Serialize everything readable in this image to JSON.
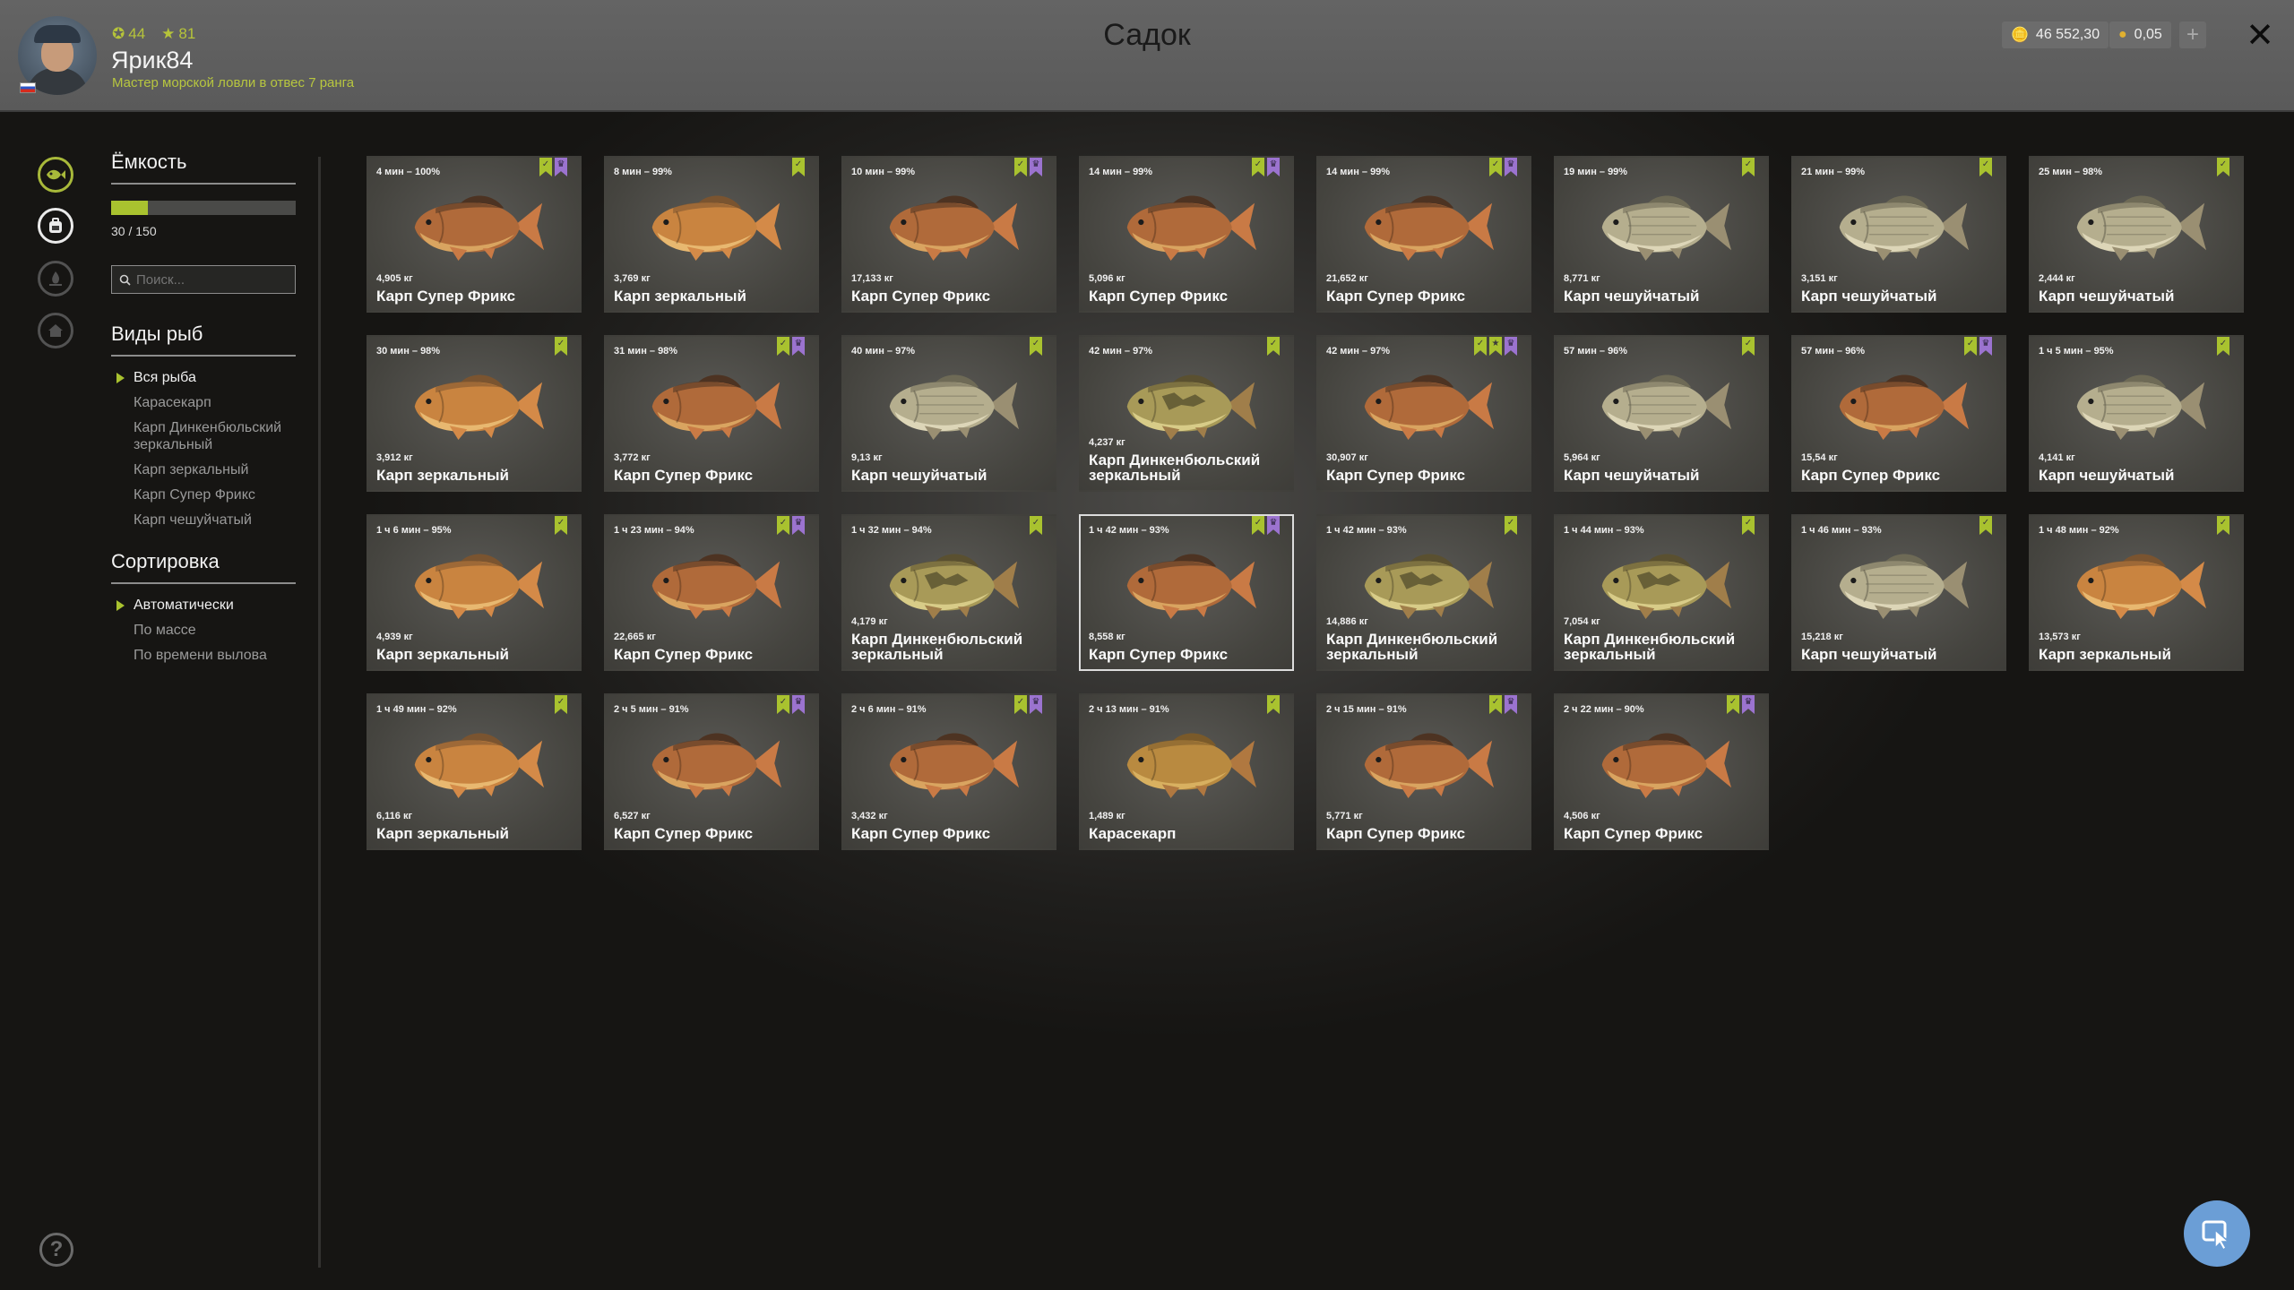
{
  "header": {
    "title": "Садок",
    "player": {
      "name": "Ярик84",
      "level": "44",
      "rank_level": "81",
      "rank_title": "Мастер морской ловли в отвес 7 ранга",
      "avatar_icon": "fisherman-avatar",
      "flag_icon": "russia-flag-icon"
    },
    "currency": {
      "silver": "46 552,30",
      "gold": "0,05",
      "add_label": "+"
    },
    "close_label": "✕"
  },
  "rail": {
    "icons": [
      "fish-keepnet-icon",
      "backpack-icon",
      "campfire-icon",
      "home-icon"
    ],
    "help_label": "?"
  },
  "panel": {
    "capacity": {
      "title": "Ёмкость",
      "used": 30,
      "total": 150,
      "text": "30 / 150"
    },
    "search": {
      "placeholder": "Поиск..."
    },
    "species": {
      "title": "Виды рыб",
      "options": [
        "Вся рыба",
        "Карасекарп",
        "Карп Динкенбюльский зеркальный",
        "Карп зеркальный",
        "Карп Супер Фрикс",
        "Карп чешуйчатый"
      ],
      "selected": 0
    },
    "sort": {
      "title": "Сортировка",
      "options": [
        "Автоматически",
        "По массе",
        "По времени вылова"
      ],
      "selected": 0
    }
  },
  "colors": {
    "accent": "#a9c22f",
    "purple_badge": "#9b73cf",
    "card_bg": "#45443f",
    "cursor_button": "#6b9ed6"
  },
  "fish": [
    {
      "time": "4 мин – 100%",
      "weight": "4,905 кг",
      "name": "Карп Супер Фрикс",
      "type": "frix",
      "badges": [
        "green",
        "purple"
      ]
    },
    {
      "time": "8 мин – 99%",
      "weight": "3,769 кг",
      "name": "Карп зеркальный",
      "type": "mirror",
      "badges": [
        "green"
      ]
    },
    {
      "time": "10 мин – 99%",
      "weight": "17,133 кг",
      "name": "Карп Супер Фрикс",
      "type": "frix",
      "badges": [
        "green",
        "purple"
      ]
    },
    {
      "time": "14 мин – 99%",
      "weight": "5,096 кг",
      "name": "Карп Супер Фрикс",
      "type": "frix",
      "badges": [
        "green",
        "purple"
      ]
    },
    {
      "time": "14 мин – 99%",
      "weight": "21,652 кг",
      "name": "Карп Супер Фрикс",
      "type": "frix",
      "badges": [
        "green",
        "purple"
      ]
    },
    {
      "time": "19 мин – 99%",
      "weight": "8,771 кг",
      "name": "Карп чешуйчатый",
      "type": "scaly",
      "badges": [
        "green"
      ]
    },
    {
      "time": "21 мин – 99%",
      "weight": "3,151 кг",
      "name": "Карп чешуйчатый",
      "type": "scaly",
      "badges": [
        "green"
      ]
    },
    {
      "time": "25 мин – 98%",
      "weight": "2,444 кг",
      "name": "Карп чешуйчатый",
      "type": "scaly",
      "badges": [
        "green"
      ]
    },
    {
      "time": "30 мин – 98%",
      "weight": "3,912 кг",
      "name": "Карп зеркальный",
      "type": "mirror",
      "badges": [
        "green"
      ]
    },
    {
      "time": "31 мин – 98%",
      "weight": "3,772 кг",
      "name": "Карп Супер Фрикс",
      "type": "frix",
      "badges": [
        "green",
        "purple"
      ]
    },
    {
      "time": "40 мин – 97%",
      "weight": "9,13 кг",
      "name": "Карп чешуйчатый",
      "type": "scaly",
      "badges": [
        "green"
      ]
    },
    {
      "time": "42 мин – 97%",
      "weight": "4,237 кг",
      "name": "Карп Динкенбюльский зеркальный",
      "type": "dink",
      "badges": [
        "green"
      ]
    },
    {
      "time": "42 мин – 97%",
      "weight": "30,907 кг",
      "name": "Карп Супер Фрикс",
      "type": "frix",
      "badges": [
        "green",
        "star",
        "purple"
      ]
    },
    {
      "time": "57 мин – 96%",
      "weight": "5,964 кг",
      "name": "Карп чешуйчатый",
      "type": "scaly",
      "badges": [
        "green"
      ]
    },
    {
      "time": "57 мин – 96%",
      "weight": "15,54 кг",
      "name": "Карп Супер Фрикс",
      "type": "frix",
      "badges": [
        "green",
        "purple"
      ]
    },
    {
      "time": "1 ч 5 мин – 95%",
      "weight": "4,141 кг",
      "name": "Карп чешуйчатый",
      "type": "scaly",
      "badges": [
        "green"
      ]
    },
    {
      "time": "1 ч 6 мин – 95%",
      "weight": "4,939 кг",
      "name": "Карп зеркальный",
      "type": "mirror",
      "badges": [
        "green"
      ]
    },
    {
      "time": "1 ч 23 мин – 94%",
      "weight": "22,665 кг",
      "name": "Карп Супер Фрикс",
      "type": "frix",
      "badges": [
        "green",
        "purple"
      ]
    },
    {
      "time": "1 ч 32 мин – 94%",
      "weight": "4,179 кг",
      "name": "Карп Динкенбюльский зеркальный",
      "type": "dink",
      "badges": [
        "green"
      ]
    },
    {
      "time": "1 ч 42 мин – 93%",
      "weight": "8,558 кг",
      "name": "Карп Супер Фрикс",
      "type": "frix",
      "badges": [
        "green",
        "purple"
      ],
      "selected": true
    },
    {
      "time": "1 ч 42 мин – 93%",
      "weight": "14,886 кг",
      "name": "Карп Динкенбюльский зеркальный",
      "type": "dink",
      "badges": [
        "green"
      ]
    },
    {
      "time": "1 ч 44 мин – 93%",
      "weight": "7,054 кг",
      "name": "Карп Динкенбюльский зеркальный",
      "type": "dink",
      "badges": [
        "green"
      ]
    },
    {
      "time": "1 ч 46 мин – 93%",
      "weight": "15,218 кг",
      "name": "Карп чешуйчатый",
      "type": "scaly",
      "badges": [
        "green"
      ]
    },
    {
      "time": "1 ч 48 мин – 92%",
      "weight": "13,573 кг",
      "name": "Карп зеркальный",
      "type": "mirror",
      "badges": [
        "green"
      ]
    },
    {
      "time": "1 ч 49 мин – 92%",
      "weight": "6,116 кг",
      "name": "Карп зеркальный",
      "type": "mirror",
      "badges": [
        "green"
      ]
    },
    {
      "time": "2 ч 5 мин – 91%",
      "weight": "6,527 кг",
      "name": "Карп Супер Фрикс",
      "type": "frix",
      "badges": [
        "green",
        "purple"
      ]
    },
    {
      "time": "2 ч 6 мин – 91%",
      "weight": "3,432 кг",
      "name": "Карп Супер Фрикс",
      "type": "frix",
      "badges": [
        "green",
        "purple"
      ]
    },
    {
      "time": "2 ч 13 мин – 91%",
      "weight": "1,489 кг",
      "name": "Карасекарп",
      "type": "crucian",
      "badges": [
        "green"
      ]
    },
    {
      "time": "2 ч 15 мин – 91%",
      "weight": "5,771 кг",
      "name": "Карп Супер Фрикс",
      "type": "frix",
      "badges": [
        "green",
        "purple"
      ]
    },
    {
      "time": "2 ч 22 мин – 90%",
      "weight": "4,506 кг",
      "name": "Карп Супер Фрикс",
      "type": "frix",
      "badges": [
        "green",
        "purple"
      ]
    }
  ]
}
